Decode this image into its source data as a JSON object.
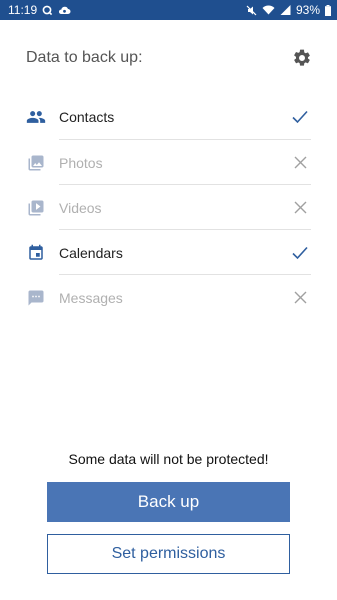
{
  "status_bar": {
    "time": "11:19",
    "battery": "93%",
    "left_icons": [
      "q-icon",
      "cloud-sync-icon"
    ],
    "right_icons": [
      "mute-icon",
      "wifi-icon",
      "signal-icon",
      "battery-icon"
    ]
  },
  "header": {
    "title": "Data to back up:",
    "settings_icon": "gear-icon"
  },
  "items": [
    {
      "label": "Contacts",
      "icon": "contacts-icon",
      "enabled": true,
      "state_icon": "check-icon"
    },
    {
      "label": "Photos",
      "icon": "photo-icon",
      "enabled": false,
      "state_icon": "close-icon"
    },
    {
      "label": "Videos",
      "icon": "video-icon",
      "enabled": false,
      "state_icon": "close-icon"
    },
    {
      "label": "Calendars",
      "icon": "calendar-icon",
      "enabled": true,
      "state_icon": "check-icon"
    },
    {
      "label": "Messages",
      "icon": "message-icon",
      "enabled": false,
      "state_icon": "close-icon"
    }
  ],
  "warning": "Some data will not be protected!",
  "buttons": {
    "back_up": "Back up",
    "set_permissions": "Set permissions"
  },
  "colors": {
    "status_bar": "#1f4f8f",
    "accent": "#2f5f9f",
    "primary_button": "#4a75b5",
    "disabled": "#b0b0b0"
  }
}
